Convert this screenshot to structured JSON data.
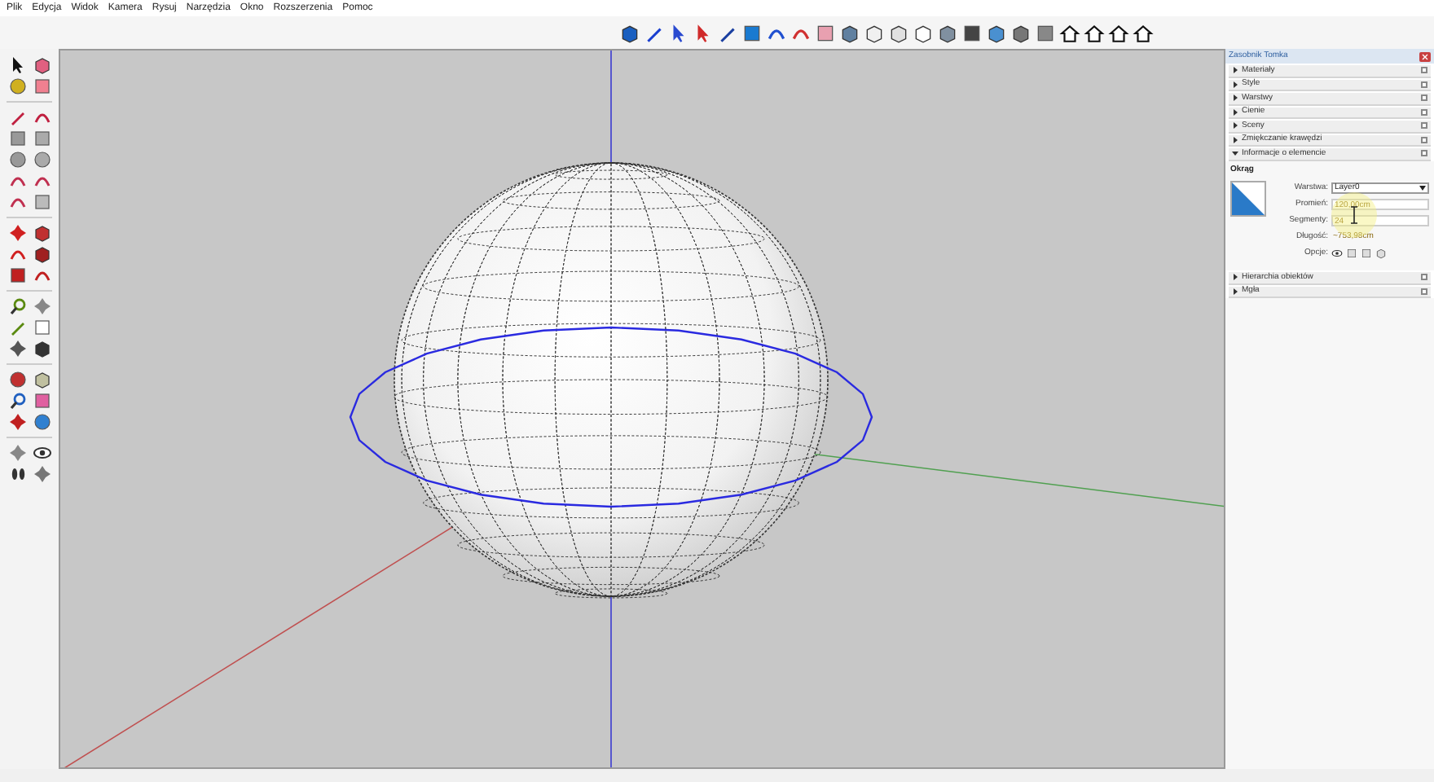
{
  "menu_bar": [
    "Plik",
    "Edycja",
    "Widok",
    "Kamera",
    "Rysuj",
    "Narzędzia",
    "Okno",
    "Rozszerzenia",
    "Pomoc"
  ],
  "tray": {
    "title": "Zasobnik Tomka",
    "sections": [
      {
        "label": "Materiały",
        "expanded": false
      },
      {
        "label": "Style",
        "expanded": false
      },
      {
        "label": "Warstwy",
        "expanded": false
      },
      {
        "label": "Cienie",
        "expanded": false
      },
      {
        "label": "Sceny",
        "expanded": false
      },
      {
        "label": "Zmiękczanie krawędzi",
        "expanded": false
      },
      {
        "label": "Informacje o elemencie",
        "expanded": true
      }
    ],
    "entity_info": {
      "heading": "Okrąg",
      "fields": [
        {
          "kind": "dropdown",
          "label": "Warstwa:",
          "value": "Layer0"
        },
        {
          "kind": "input",
          "label": "Promień:",
          "value": "120,00cm"
        },
        {
          "kind": "input",
          "label": "Segmenty:",
          "value": "24"
        },
        {
          "kind": "readout",
          "label": "Długość:",
          "value": "~753,98cm"
        },
        {
          "kind": "options",
          "label": "Opcje:"
        }
      ]
    },
    "lower_sections": [
      {
        "label": "Hierarchia obiektów",
        "expanded": false
      },
      {
        "label": "Mgła",
        "expanded": false
      }
    ]
  }
}
